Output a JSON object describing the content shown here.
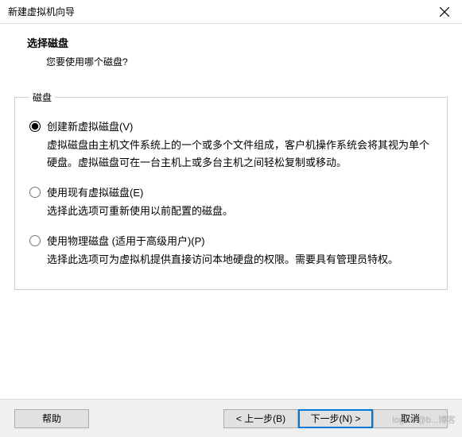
{
  "window": {
    "title": "新建虚拟机向导"
  },
  "header": {
    "heading": "选择磁盘",
    "subheading": "您要使用哪个磁盘?"
  },
  "group": {
    "legend": "磁盘"
  },
  "options": {
    "create_new": {
      "label": "创建新虚拟磁盘(V)",
      "desc": "虚拟磁盘由主机文件系统上的一个或多个文件组成，客户机操作系统会将其视为单个硬盘。虚拟磁盘可在一台主机上或多台主机之间轻松复制或移动。",
      "selected": true
    },
    "use_existing": {
      "label": "使用现有虚拟磁盘(E)",
      "desc": "选择此选项可重新使用以前配置的磁盘。",
      "selected": false
    },
    "use_physical": {
      "label": "使用物理磁盘 (适用于高级用户)(P)",
      "desc": "选择此选项可为虚拟机提供直接访问本地硬盘的权限。需要具有管理员特权。",
      "selected": false
    }
  },
  "buttons": {
    "help": "帮助",
    "back": "< 上一步(B)",
    "next": "下一步(N) >",
    "cancel": "取消"
  },
  "watermark": "logics @b...博客"
}
